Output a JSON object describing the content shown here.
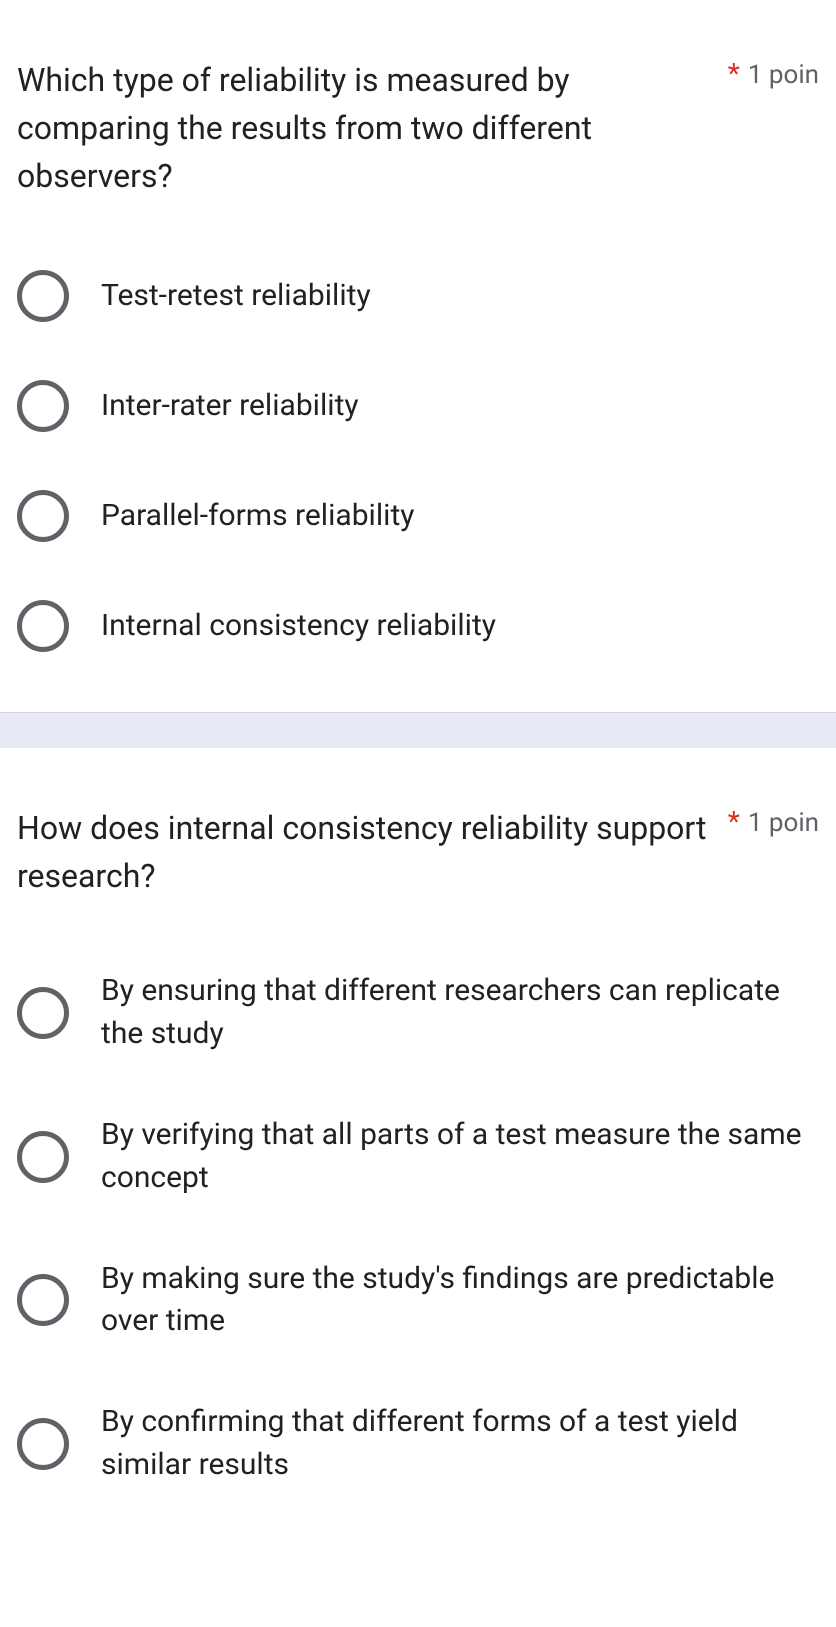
{
  "questions": [
    {
      "title": "Which type of reliability is measured by comparing the results from two different observers?",
      "required": "*",
      "points": "1 poin",
      "options": [
        "Test-retest reliability",
        "Inter-rater reliability",
        "Parallel-forms reliability",
        "Internal consistency reliability"
      ]
    },
    {
      "title": "How does internal consistency reliability support research?",
      "required": "*",
      "points": "1 poin",
      "options": [
        "By ensuring that different researchers can replicate the study",
        "By verifying that all parts of a test measure the same concept",
        "By making sure the study's findings are predictable over time",
        "By confirming that different forms of a test yield similar results"
      ]
    }
  ]
}
